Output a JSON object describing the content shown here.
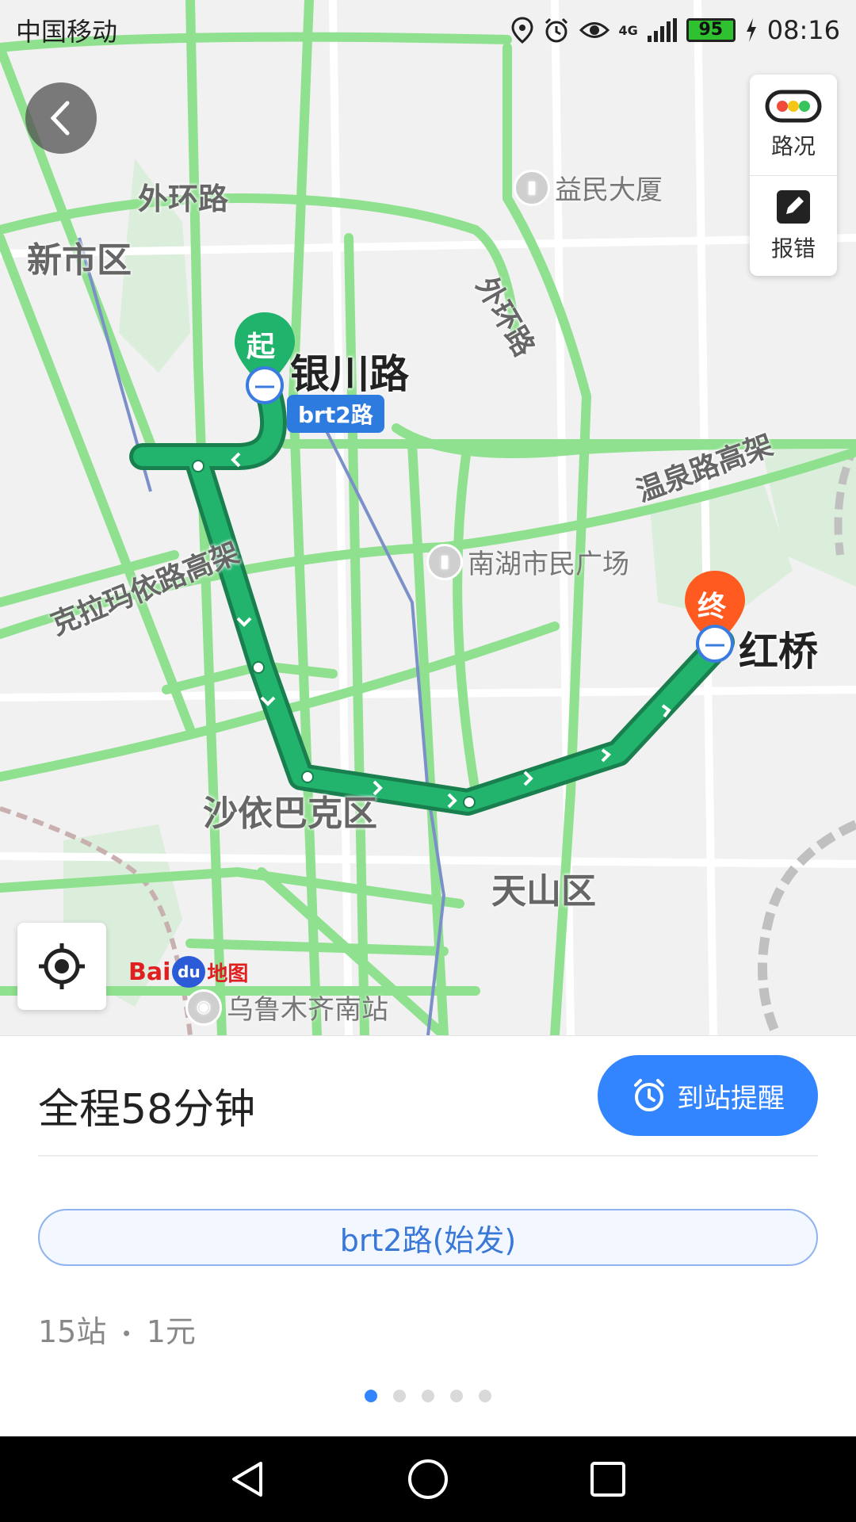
{
  "status_bar": {
    "carrier": "中国移动",
    "network": "4G",
    "battery": "95",
    "time": "08:16"
  },
  "map": {
    "side_panel": {
      "traffic_label": "路况",
      "report_label": "报错"
    },
    "districts": {
      "xinshi": "新市区",
      "shayibake": "沙依巴克区",
      "tianshan": "天山区"
    },
    "roads": {
      "waihuan_top": "外环路",
      "waihuan_diag": "外环路",
      "wenquan": "温泉路高架",
      "kelamayi": "克拉玛依路高架"
    },
    "pois": {
      "yimin": "益民大厦",
      "nanhu": "南湖市民广场",
      "south_station": "乌鲁木齐南站"
    },
    "start": {
      "marker": "起",
      "name": "银川路",
      "line_badge": "brt2路"
    },
    "end": {
      "marker": "终",
      "name": "红桥"
    },
    "logo": {
      "brand_left": "Bai",
      "brand_paw": "du",
      "brand_cn": "地图"
    }
  },
  "route": {
    "duration": "全程58分钟",
    "remind_label": "到站提醒",
    "line_name": "brt2路(始发)",
    "stops": "15站",
    "separator": "•",
    "fare": "1元",
    "pages": 5,
    "active_page": 1
  },
  "colors": {
    "route": "#1aa463",
    "road": "#8fe08f",
    "accent": "#3385ff",
    "start_marker": "#1fb36b",
    "end_marker": "#ff5a1f"
  }
}
